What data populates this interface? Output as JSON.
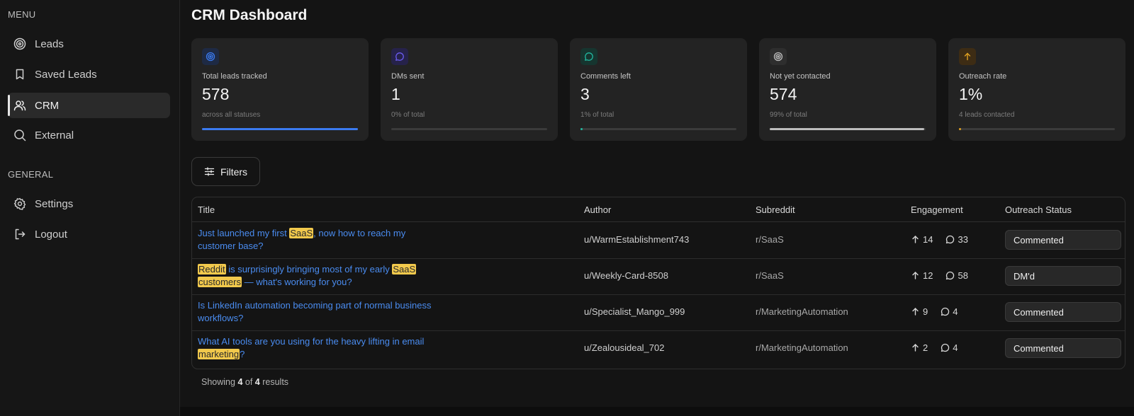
{
  "sidebar": {
    "menu_label": "MENU",
    "general_label": "GENERAL",
    "items": [
      {
        "label": "Leads",
        "icon": "target-icon"
      },
      {
        "label": "Saved Leads",
        "icon": "bookmark-icon"
      },
      {
        "label": "CRM",
        "icon": "users-icon",
        "active": true
      },
      {
        "label": "External",
        "icon": "search-icon"
      }
    ],
    "general_items": [
      {
        "label": "Settings",
        "icon": "gear-icon"
      },
      {
        "label": "Logout",
        "icon": "logout-icon"
      }
    ]
  },
  "header": {
    "title": "CRM Dashboard"
  },
  "stats": [
    {
      "label": "Total leads tracked",
      "value": "578",
      "sub": "across all statuses",
      "progress": 1.0,
      "color": "#3b7bf0",
      "icon": "target-icon"
    },
    {
      "label": "DMs sent",
      "value": "1",
      "sub": "0% of total",
      "progress": 0.0,
      "color": "#6b5cf0",
      "icon": "message-icon"
    },
    {
      "label": "Comments left",
      "value": "3",
      "sub": "1% of total",
      "progress": 0.01,
      "color": "#22b8a0",
      "icon": "comment-icon"
    },
    {
      "label": "Not yet contacted",
      "value": "574",
      "sub": "99% of total",
      "progress": 0.99,
      "color": "#bdbdbd",
      "icon": "target-icon"
    },
    {
      "label": "Outreach rate",
      "value": "1%",
      "sub": "4 leads contacted",
      "progress": 0.01,
      "color": "#e0a020",
      "icon": "arrow-up-icon"
    }
  ],
  "filters": {
    "label": "Filters"
  },
  "table": {
    "columns": [
      "Title",
      "Author",
      "Subreddit",
      "Engagement",
      "Outreach Status"
    ],
    "rows": [
      {
        "title_line1": [
          {
            "t": "Just launched my first "
          },
          {
            "t": "SaaS",
            "hl": true
          },
          {
            "t": ", now how to reach my"
          }
        ],
        "title_line2": [
          {
            "t": "customer base?"
          }
        ],
        "author": "u/WarmEstablishment743",
        "subreddit": "r/SaaS",
        "upvotes": "14",
        "comments": "33",
        "status": "Commented"
      },
      {
        "title_line1": [
          {
            "t": "Reddit",
            "hl": true
          },
          {
            "t": " is surprisingly bringing most of my early "
          },
          {
            "t": "SaaS",
            "hl": true
          }
        ],
        "title_line2": [
          {
            "t": "customers",
            "hl": true
          },
          {
            "t": " — what's working for you?"
          }
        ],
        "author": "u/Weekly-Card-8508",
        "subreddit": "r/SaaS",
        "upvotes": "12",
        "comments": "58",
        "status": "DM'd"
      },
      {
        "title_line1": [
          {
            "t": "Is LinkedIn automation becoming part of normal business"
          }
        ],
        "title_line2": [
          {
            "t": "workflows?"
          }
        ],
        "author": "u/Specialist_Mango_999",
        "subreddit": "r/MarketingAutomation",
        "upvotes": "9",
        "comments": "4",
        "status": "Commented"
      },
      {
        "title_line1": [
          {
            "t": "What AI tools are you using for the heavy lifting in email"
          }
        ],
        "title_line2": [
          {
            "t": "marketing",
            "hl": true
          },
          {
            "t": "?"
          }
        ],
        "author": "u/Zealousideal_702",
        "subreddit": "r/MarketingAutomation",
        "upvotes": "2",
        "comments": "4",
        "status": "Commented"
      }
    ]
  },
  "footer": {
    "showing_prefix": "Showing",
    "shown": "4",
    "of_word": "of",
    "total": "4",
    "results_word": "results"
  }
}
